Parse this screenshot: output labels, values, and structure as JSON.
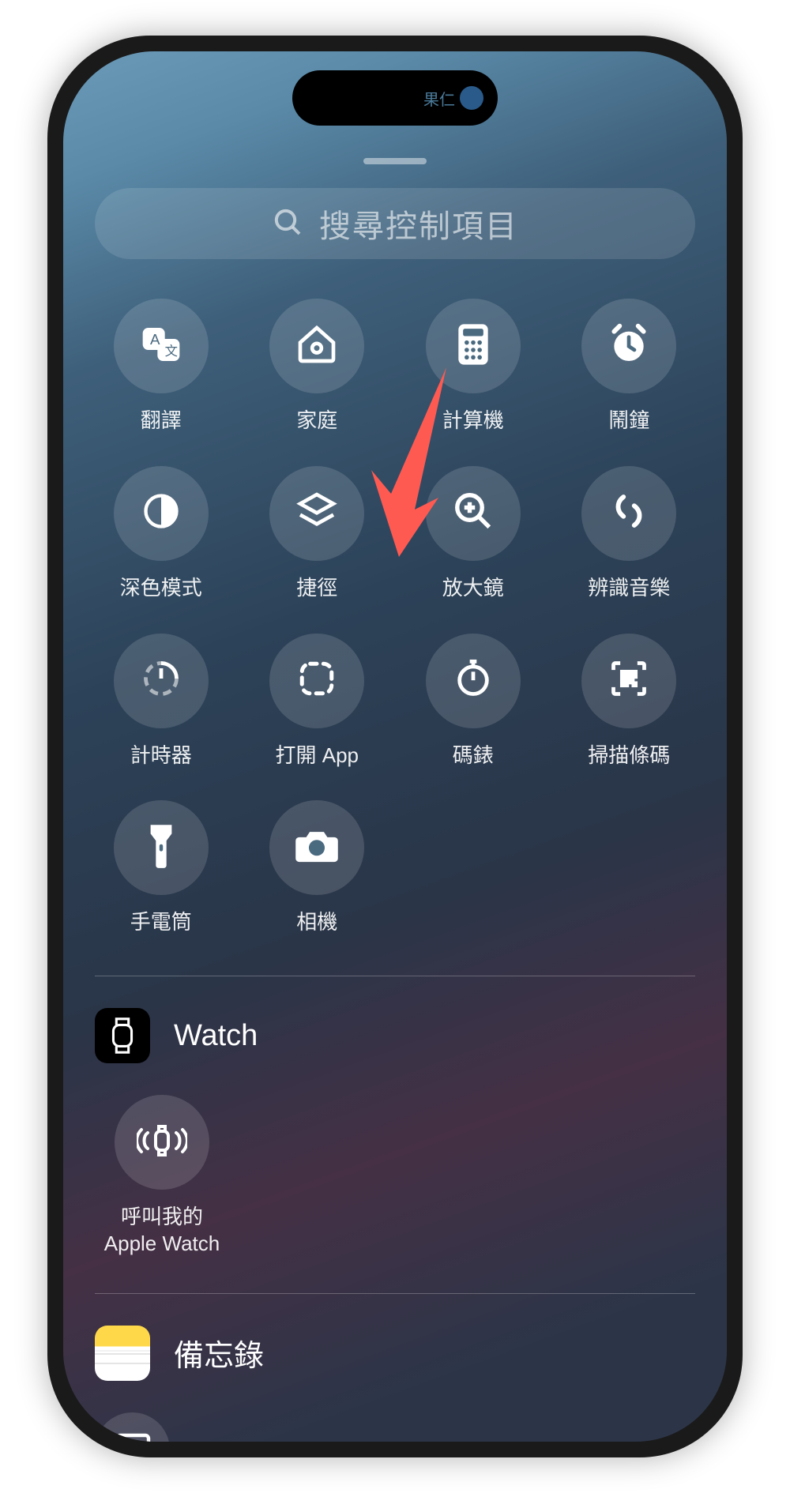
{
  "island": {
    "text": "果仁"
  },
  "search": {
    "placeholder": "搜尋控制項目"
  },
  "controls": [
    {
      "id": "translate",
      "label": "翻譯"
    },
    {
      "id": "home",
      "label": "家庭"
    },
    {
      "id": "calculator",
      "label": "計算機"
    },
    {
      "id": "alarm",
      "label": "鬧鐘"
    },
    {
      "id": "darkmode",
      "label": "深色模式"
    },
    {
      "id": "shortcuts",
      "label": "捷徑"
    },
    {
      "id": "magnifier",
      "label": "放大鏡"
    },
    {
      "id": "recognize-music",
      "label": "辨識音樂"
    },
    {
      "id": "timer",
      "label": "計時器"
    },
    {
      "id": "open-app",
      "label": "打開 App"
    },
    {
      "id": "stopwatch",
      "label": "碼錶"
    },
    {
      "id": "scan-code",
      "label": "掃描條碼"
    },
    {
      "id": "flashlight",
      "label": "手電筒"
    },
    {
      "id": "camera",
      "label": "相機"
    }
  ],
  "sections": {
    "watch": {
      "title": "Watch",
      "item_label": "呼叫我的\nApple Watch"
    },
    "notes": {
      "title": "備忘錄"
    }
  }
}
